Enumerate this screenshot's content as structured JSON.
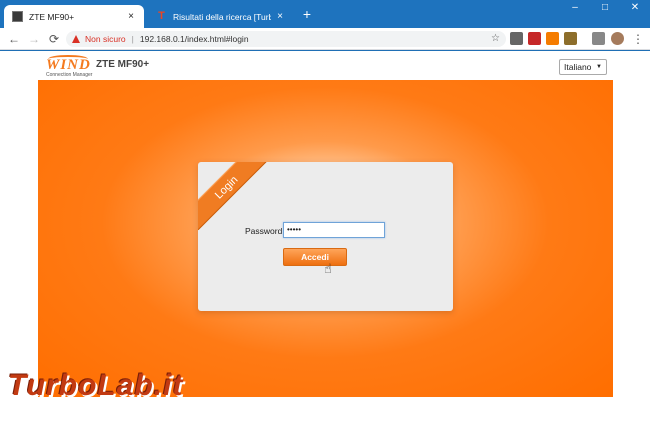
{
  "browser": {
    "tabs": [
      {
        "title": "ZTE MF90+",
        "close": "×"
      },
      {
        "title": "Risultati della ricerca [TurboLab.i",
        "close": "×"
      }
    ],
    "new_tab": "+",
    "window_controls": {
      "minimize": "–",
      "maximize": "□",
      "close": "✕"
    },
    "nav": {
      "back": "←",
      "forward": "→",
      "reload": "⟳"
    },
    "address": {
      "security_label": "Non sicuro",
      "separator": "|",
      "url": "192.168.0.1/index.html#login",
      "star": "☆"
    },
    "menu": "⋮"
  },
  "page": {
    "logo_text": "WIND",
    "logo_sub": "Connection Manager",
    "product_name": "ZTE MF90+",
    "language": {
      "selected": "Italiano",
      "caret": "▼"
    },
    "login": {
      "ribbon": "Login",
      "password_label": "Password",
      "password_value": "•••••",
      "submit_label": "Accedi"
    }
  },
  "watermark": "TurboLab.it",
  "colors": {
    "accent": "#ff6e00",
    "chrome_blue": "#1e73be",
    "warning": "#d93025"
  }
}
